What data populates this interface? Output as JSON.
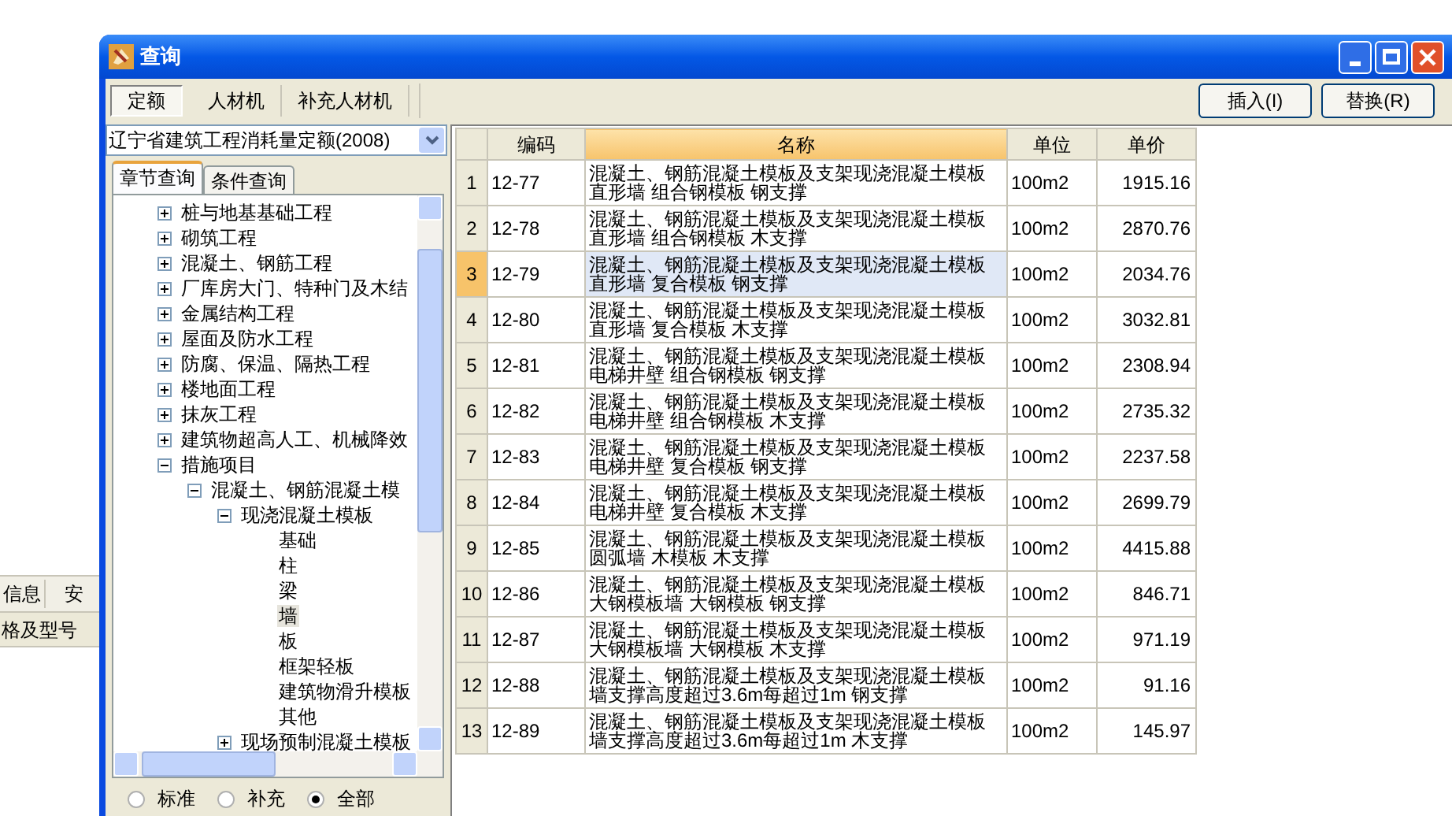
{
  "background_app": {
    "tabs": [
      "信息",
      "安"
    ],
    "column_header": "格及型号"
  },
  "window": {
    "title": "查询"
  },
  "tabs": [
    {
      "label": "定额",
      "selected": true
    },
    {
      "label": "人材机",
      "selected": false
    },
    {
      "label": "补充人材机",
      "selected": false
    }
  ],
  "buttons": [
    "插入(I)",
    "替换(R)"
  ],
  "quota_select": {
    "value": "辽宁省建筑工程消耗量定额(2008)"
  },
  "query_tabs": [
    {
      "label": "章节查询",
      "selected": true
    },
    {
      "label": "条件查询",
      "selected": false
    }
  ],
  "tree": [
    {
      "label": "桩与地基基础工程",
      "expanded": false,
      "selected": false
    },
    {
      "label": "砌筑工程",
      "expanded": false,
      "selected": false
    },
    {
      "label": "混凝土、钢筋工程",
      "expanded": false,
      "selected": false
    },
    {
      "label": "厂库房大门、特种门及木结",
      "expanded": false,
      "selected": false
    },
    {
      "label": "金属结构工程",
      "expanded": false,
      "selected": false
    },
    {
      "label": "屋面及防水工程",
      "expanded": false,
      "selected": false
    },
    {
      "label": "防腐、保温、隔热工程",
      "expanded": false,
      "selected": false
    },
    {
      "label": "楼地面工程",
      "expanded": false,
      "selected": false
    },
    {
      "label": "抹灰工程",
      "expanded": false,
      "selected": false
    },
    {
      "label": "建筑物超高人工、机械降效",
      "expanded": false,
      "selected": false
    },
    {
      "label": "措施项目",
      "expanded": true,
      "selected": false,
      "children": [
        {
          "label": "混凝土、钢筋混凝土模",
          "expanded": true,
          "selected": false,
          "children": [
            {
              "label": "现浇混凝土模板",
              "expanded": true,
              "selected": false,
              "children": [
                {
                  "label": "基础",
                  "selected": false
                },
                {
                  "label": "柱",
                  "selected": false
                },
                {
                  "label": "梁",
                  "selected": false
                },
                {
                  "label": "墙",
                  "selected": true
                },
                {
                  "label": "板",
                  "selected": false
                },
                {
                  "label": "框架轻板",
                  "selected": false
                },
                {
                  "label": "建筑物滑升模板",
                  "selected": false
                },
                {
                  "label": "其他",
                  "selected": false
                }
              ]
            },
            {
              "label": "现场预制混凝土模板",
              "expanded": false,
              "selected": false
            }
          ]
        }
      ]
    }
  ],
  "filters": [
    {
      "label": "标准",
      "selected": false
    },
    {
      "label": "补充",
      "selected": false
    },
    {
      "label": "全部",
      "selected": true
    }
  ],
  "table": {
    "columns": [
      {
        "label": "编码",
        "selected": false
      },
      {
        "label": "名称",
        "selected": true
      },
      {
        "label": "单位",
        "selected": false
      },
      {
        "label": "单价",
        "selected": false
      }
    ],
    "rows": [
      {
        "no": "1",
        "code": "12-77",
        "name": [
          "混凝土、钢筋混凝土模板及支架现浇混凝土模板",
          "直形墙 组合钢模板 钢支撑"
        ],
        "unit": "100m2",
        "price": "1915.16",
        "selected": false
      },
      {
        "no": "2",
        "code": "12-78",
        "name": [
          "混凝土、钢筋混凝土模板及支架现浇混凝土模板",
          "直形墙 组合钢模板 木支撑"
        ],
        "unit": "100m2",
        "price": "2870.76",
        "selected": false
      },
      {
        "no": "3",
        "code": "12-79",
        "name": [
          "混凝土、钢筋混凝土模板及支架现浇混凝土模板",
          "直形墙 复合模板 钢支撑"
        ],
        "unit": "100m2",
        "price": "2034.76",
        "selected": true
      },
      {
        "no": "4",
        "code": "12-80",
        "name": [
          "混凝土、钢筋混凝土模板及支架现浇混凝土模板",
          "直形墙 复合模板 木支撑"
        ],
        "unit": "100m2",
        "price": "3032.81",
        "selected": false
      },
      {
        "no": "5",
        "code": "12-81",
        "name": [
          "混凝土、钢筋混凝土模板及支架现浇混凝土模板",
          "电梯井壁 组合钢模板 钢支撑"
        ],
        "unit": "100m2",
        "price": "2308.94",
        "selected": false
      },
      {
        "no": "6",
        "code": "12-82",
        "name": [
          "混凝土、钢筋混凝土模板及支架现浇混凝土模板",
          "电梯井壁 组合钢模板 木支撑"
        ],
        "unit": "100m2",
        "price": "2735.32",
        "selected": false
      },
      {
        "no": "7",
        "code": "12-83",
        "name": [
          "混凝土、钢筋混凝土模板及支架现浇混凝土模板",
          "电梯井壁 复合模板 钢支撑"
        ],
        "unit": "100m2",
        "price": "2237.58",
        "selected": false
      },
      {
        "no": "8",
        "code": "12-84",
        "name": [
          "混凝土、钢筋混凝土模板及支架现浇混凝土模板",
          "电梯井壁 复合模板 木支撑"
        ],
        "unit": "100m2",
        "price": "2699.79",
        "selected": false
      },
      {
        "no": "9",
        "code": "12-85",
        "name": [
          "混凝土、钢筋混凝土模板及支架现浇混凝土模板",
          "圆弧墙 木模板 木支撑"
        ],
        "unit": "100m2",
        "price": "4415.88",
        "selected": false
      },
      {
        "no": "10",
        "code": "12-86",
        "name": [
          "混凝土、钢筋混凝土模板及支架现浇混凝土模板",
          "大钢模板墙 大钢模板 钢支撑"
        ],
        "unit": "100m2",
        "price": "846.71",
        "selected": false
      },
      {
        "no": "11",
        "code": "12-87",
        "name": [
          "混凝土、钢筋混凝土模板及支架现浇混凝土模板",
          "大钢模板墙 大钢模板 木支撑"
        ],
        "unit": "100m2",
        "price": "971.19",
        "selected": false
      },
      {
        "no": "12",
        "code": "12-88",
        "name": [
          "混凝土、钢筋混凝土模板及支架现浇混凝土模板",
          "墙支撑高度超过3.6m每超过1m 钢支撑"
        ],
        "unit": "100m2",
        "price": "91.16",
        "selected": false
      },
      {
        "no": "13",
        "code": "12-89",
        "name": [
          "混凝土、钢筋混凝土模板及支架现浇混凝土模板",
          "墙支撑高度超过3.6m每超过1m 木支撑"
        ],
        "unit": "100m2",
        "price": "145.97",
        "selected": false
      }
    ]
  }
}
